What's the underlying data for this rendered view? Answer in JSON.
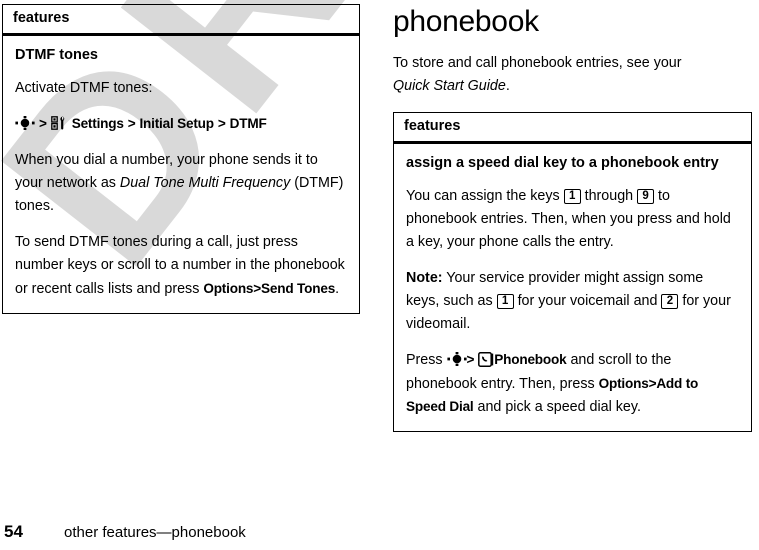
{
  "document": {
    "watermark": "DRAFT",
    "chapter_title": "phonebook",
    "intro": {
      "lead": "To store and call phonebook entries, see your ",
      "emphasis": "Quick Start Guide",
      "tail": "."
    }
  },
  "left_table": {
    "header": "features",
    "subhead": "DTMF tones",
    "paragraph_1": "Activate DTMF tones:",
    "menu_path": {
      "nav_icon": "navigation-key-icon",
      "sep1": ">",
      "settings_icon": "settings-tools-icon",
      "settings_label": "Settings",
      "sep2": ">",
      "initial_setup_label": "Initial Setup",
      "sep3": ">",
      "dtmf_label": "DTMF"
    },
    "paragraph_2": {
      "before": "When you dial a number, your phone sends it to your network as ",
      "emphasis": "Dual Tone Multi Frequency",
      "after": " (DTMF) tones."
    },
    "paragraph_3": {
      "before": "To send DTMF tones during a call, just press number keys or scroll to a number in the phonebook or recent calls lists and press ",
      "options_label": "Options",
      "sep": ">",
      "send_tones_label": "Send Tones",
      "after": "."
    }
  },
  "right_table": {
    "header": "features",
    "subhead": "assign a speed dial key to a phonebook entry",
    "paragraph_1": {
      "before": "You can assign the keys ",
      "key_first": "1",
      "middle": " through ",
      "key_last": "9",
      "after": " to phonebook entries. Then, when you press and hold a key, your phone calls the entry."
    },
    "paragraph_2": {
      "note_label": "Note:",
      "before": " Your service provider might assign some keys, such as ",
      "key_voicemail": "1",
      "middle": " for your voicemail and ",
      "key_videomail": "2",
      "after": " for your videomail."
    },
    "paragraph_3": {
      "before": "Press ",
      "nav_icon": "navigation-key-icon",
      "sep1": ">",
      "phonebook_icon": "phonebook-icon",
      "phonebook_label": "Phonebook",
      "middle": " and scroll to the phonebook entry. Then, press ",
      "options_label": "Options",
      "sep2": ">",
      "add_speed_dial_label": "Add to Speed Dial",
      "after": " and pick a speed dial key."
    }
  },
  "footer": {
    "page_number": "54",
    "breadcrumb": "other features—phonebook"
  },
  "colors": {
    "text": "#000000",
    "watermark": "#d9d9d9",
    "background": "#ffffff",
    "rule": "#000000"
  }
}
